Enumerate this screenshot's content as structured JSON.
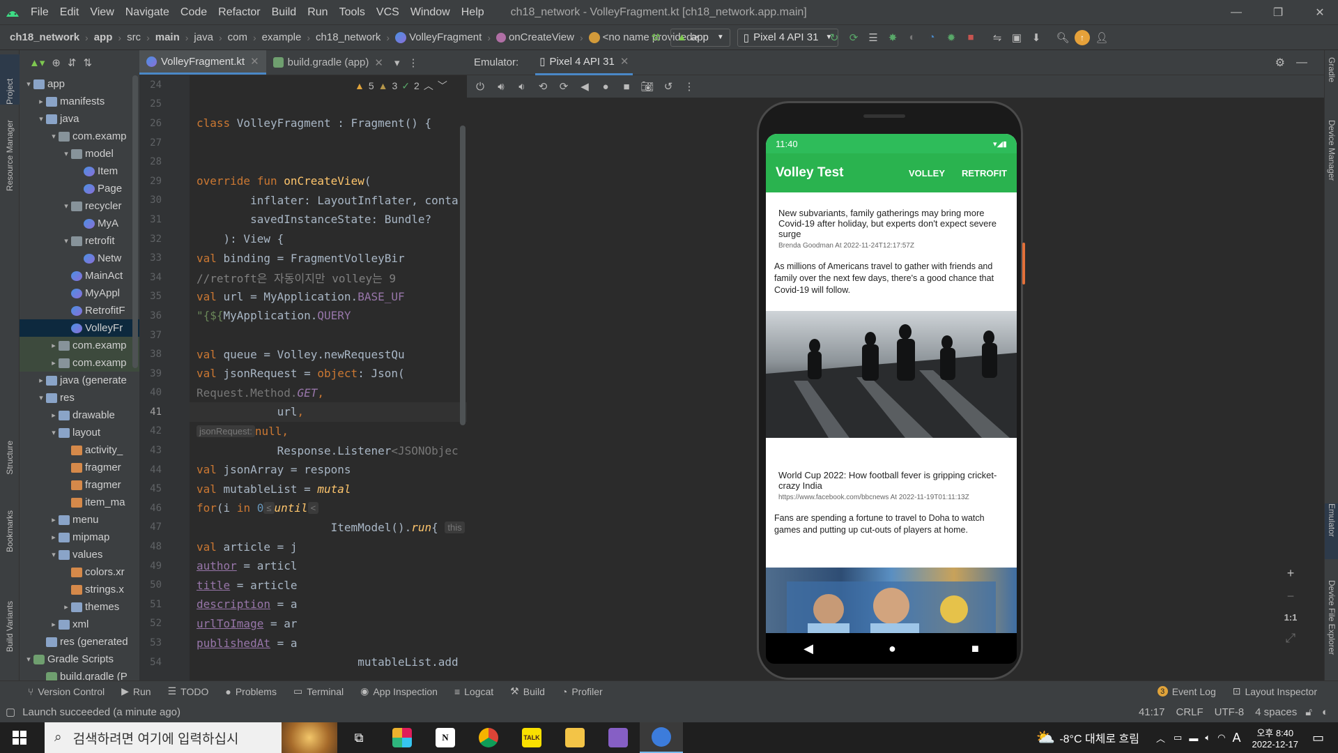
{
  "menubar": {
    "items": [
      "File",
      "Edit",
      "View",
      "Navigate",
      "Code",
      "Refactor",
      "Build",
      "Run",
      "Tools",
      "VCS",
      "Window",
      "Help"
    ],
    "title": "ch18_network - VolleyFragment.kt [ch18_network.app.main]"
  },
  "navbar": {
    "crumbs": [
      "ch18_network",
      "app",
      "src",
      "main",
      "java",
      "com",
      "example",
      "ch18_network",
      "VolleyFragment",
      "onCreateView",
      "<no name provided>"
    ],
    "run_config": "app",
    "device": "Pixel 4 API 31"
  },
  "left_strip": [
    "Project",
    "Resource Manager",
    "Structure",
    "Bookmarks",
    "Build Variants"
  ],
  "right_strip": [
    "Gradle",
    "Device Manager",
    "Emulator",
    "Device File Explorer"
  ],
  "tree": [
    {
      "label": "app",
      "depth": 0,
      "arrow": "▾",
      "icon": "folder"
    },
    {
      "label": "manifests",
      "depth": 1,
      "arrow": "▸",
      "icon": "folder"
    },
    {
      "label": "java",
      "depth": 1,
      "arrow": "▾",
      "icon": "folder"
    },
    {
      "label": "com.examp",
      "depth": 2,
      "arrow": "▾",
      "icon": "pkg"
    },
    {
      "label": "model",
      "depth": 3,
      "arrow": "▾",
      "icon": "pkg"
    },
    {
      "label": "Item",
      "depth": 4,
      "arrow": "",
      "icon": "kt"
    },
    {
      "label": "Page",
      "depth": 4,
      "arrow": "",
      "icon": "kt"
    },
    {
      "label": "recycler",
      "depth": 3,
      "arrow": "▾",
      "icon": "pkg"
    },
    {
      "label": "MyA",
      "depth": 4,
      "arrow": "",
      "icon": "kt"
    },
    {
      "label": "retrofit",
      "depth": 3,
      "arrow": "▾",
      "icon": "pkg"
    },
    {
      "label": "Netw",
      "depth": 4,
      "arrow": "",
      "icon": "kt"
    },
    {
      "label": "MainAct",
      "depth": 3,
      "arrow": "",
      "icon": "kt"
    },
    {
      "label": "MyAppl",
      "depth": 3,
      "arrow": "",
      "icon": "kt"
    },
    {
      "label": "RetrofitF",
      "depth": 3,
      "arrow": "",
      "icon": "kt"
    },
    {
      "label": "VolleyFr",
      "depth": 3,
      "arrow": "",
      "icon": "kt",
      "state": "sel"
    },
    {
      "label": "com.examp",
      "depth": 2,
      "arrow": "▸",
      "icon": "pkg",
      "state": "hl"
    },
    {
      "label": "com.examp",
      "depth": 2,
      "arrow": "▸",
      "icon": "pkg",
      "state": "hl"
    },
    {
      "label": "java (generate",
      "depth": 1,
      "arrow": "▸",
      "icon": "folder"
    },
    {
      "label": "res",
      "depth": 1,
      "arrow": "▾",
      "icon": "folder"
    },
    {
      "label": "drawable",
      "depth": 2,
      "arrow": "▸",
      "icon": "folder"
    },
    {
      "label": "layout",
      "depth": 2,
      "arrow": "▾",
      "icon": "folder"
    },
    {
      "label": "activity_",
      "depth": 3,
      "arrow": "",
      "icon": "xml"
    },
    {
      "label": "fragmer",
      "depth": 3,
      "arrow": "",
      "icon": "xml"
    },
    {
      "label": "fragmer",
      "depth": 3,
      "arrow": "",
      "icon": "xml"
    },
    {
      "label": "item_ma",
      "depth": 3,
      "arrow": "",
      "icon": "xml"
    },
    {
      "label": "menu",
      "depth": 2,
      "arrow": "▸",
      "icon": "folder"
    },
    {
      "label": "mipmap",
      "depth": 2,
      "arrow": "▸",
      "icon": "folder"
    },
    {
      "label": "values",
      "depth": 2,
      "arrow": "▾",
      "icon": "folder"
    },
    {
      "label": "colors.xr",
      "depth": 3,
      "arrow": "",
      "icon": "xml"
    },
    {
      "label": "strings.x",
      "depth": 3,
      "arrow": "",
      "icon": "xml"
    },
    {
      "label": "themes",
      "depth": 3,
      "arrow": "▸",
      "icon": "folder"
    },
    {
      "label": "xml",
      "depth": 2,
      "arrow": "▸",
      "icon": "folder"
    },
    {
      "label": "res (generated",
      "depth": 1,
      "arrow": "",
      "icon": "folder"
    },
    {
      "label": "Gradle Scripts",
      "depth": 0,
      "arrow": "▾",
      "icon": "gradle"
    },
    {
      "label": "build.gradle (P",
      "depth": 1,
      "arrow": "",
      "icon": "gradle"
    }
  ],
  "editor": {
    "tabs": [
      "VolleyFragment.kt",
      "build.gradle (app)"
    ],
    "inspections": {
      "warnings": "5",
      "weak": "3",
      "typos": "2"
    },
    "lines": [
      "24",
      "25",
      "26",
      "27",
      "28",
      "29",
      "30",
      "31",
      "32",
      "33",
      "34",
      "35",
      "36",
      "37",
      "38",
      "39",
      "40",
      "41",
      "42",
      "43",
      "44",
      "45",
      "46",
      "47",
      "48",
      "49",
      "50",
      "51",
      "52",
      "53",
      "54"
    ],
    "current_line": "41",
    "hint_label": "jsonRequest:"
  },
  "emulator": {
    "label": "Emulator:",
    "device_tab": "Pixel 4 API 31",
    "zoom": [
      "+",
      "−",
      "1:1"
    ]
  },
  "phone": {
    "time": "11:40",
    "app_title": "Volley Test",
    "actions": [
      "VOLLEY",
      "RETROFIT"
    ],
    "articles": [
      {
        "title": "New subvariants, family gatherings may bring more Covid-19 after holiday, but experts don't expect severe surge",
        "meta": "Brenda Goodman At 2022-11-24T12:17:57Z",
        "desc": "As millions of Americans travel to gather with friends and family over the next few days, there's a good chance that Covid-19 will follow."
      },
      {
        "title": "World Cup 2022: How football fever is gripping cricket-crazy India",
        "meta": "https://www.facebook.com/bbcnews At 2022-11-19T01:11:13Z",
        "desc": "Fans are spending a fortune to travel to Doha to watch games and putting up cut-outs of players at home."
      }
    ]
  },
  "toolwindows": [
    "Version Control",
    "Run",
    "TODO",
    "Problems",
    "Terminal",
    "App Inspection",
    "Logcat",
    "Build",
    "Profiler"
  ],
  "toolwindows_right": [
    "Event Log",
    "Layout Inspector"
  ],
  "event_count": "3",
  "status": {
    "message": "Launch succeeded (a minute ago)",
    "position": "41:17",
    "line_sep": "CRLF",
    "encoding": "UTF-8",
    "indent": "4 spaces"
  },
  "taskbar": {
    "search_placeholder": "검색하려면 여기에 입력하십시",
    "weather": "-8°C 대체로 흐림",
    "ime": "A",
    "time": "오후 8:40",
    "date": "2022-12-17"
  },
  "colors": {
    "accent": "#2ab34f",
    "selection": "#0d293e",
    "editor_bg": "#2b2b2b"
  }
}
